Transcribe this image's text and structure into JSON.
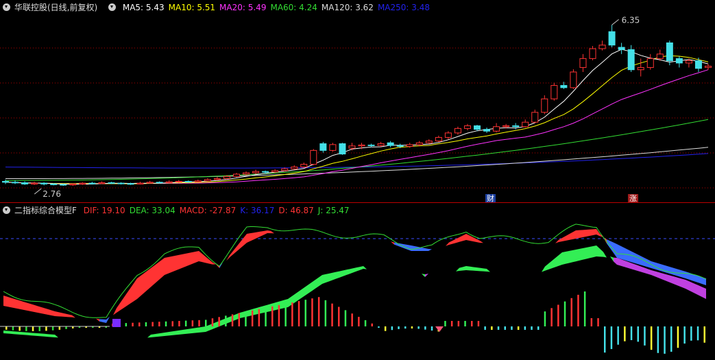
{
  "top": {
    "title": "华联控股(日线,前复权)",
    "legend": [
      {
        "label": "MA5: 5.43",
        "color": "#ffffff"
      },
      {
        "label": "MA10: 5.51",
        "color": "#ffff00"
      },
      {
        "label": "MA20: 5.49",
        "color": "#ff33ff"
      },
      {
        "label": "MA60: 4.24",
        "color": "#33dd33"
      },
      {
        "label": "MA120: 3.62",
        "color": "#dddddd"
      },
      {
        "label": "MA250: 3.48",
        "color": "#2222ee"
      }
    ],
    "high_label": "6.35",
    "low_label": "2.76",
    "tag_cai": "财",
    "tag_zhang": "涨"
  },
  "bottom": {
    "title": "二指标综合模型F",
    "legend": [
      {
        "label": "DIF: 19.10",
        "color": "#ff3333"
      },
      {
        "label": "DEA: 33.04",
        "color": "#33dd33"
      },
      {
        "label": "MACD: -27.87",
        "color": "#ff3333"
      },
      {
        "label": "K: 36.17",
        "color": "#2222ee"
      },
      {
        "label": "D: 46.87",
        "color": "#ff3333"
      },
      {
        "label": "J: 25.47",
        "color": "#33dd33"
      }
    ]
  },
  "colors": {
    "up": "#ff3333",
    "down": "#44e0e8",
    "ma5": "#ffffff",
    "ma10": "#ffff00",
    "ma20": "#ff33ff",
    "ma60": "#33dd33",
    "ma120": "#dddddd",
    "ma250": "#2222ee",
    "grid": "#b00000",
    "ribbon_red": "#ff3333",
    "ribbon_blue": "#3a6cff",
    "ribbon_purple": "#c040e0",
    "ribbon_green": "#33ee55"
  },
  "chart_data": [
    {
      "type": "candlestick",
      "title": "华联控股(日线,前复权)",
      "ylim": [
        2.5,
        6.6
      ],
      "candles": [
        [
          2.86,
          2.84,
          2.9,
          2.8
        ],
        [
          2.84,
          2.83,
          2.88,
          2.8
        ],
        [
          2.83,
          2.8,
          2.86,
          2.78
        ],
        [
          2.8,
          2.82,
          2.85,
          2.78
        ],
        [
          2.82,
          2.8,
          2.84,
          2.77
        ],
        [
          2.8,
          2.79,
          2.82,
          2.77
        ],
        [
          2.79,
          2.78,
          2.81,
          2.76
        ],
        [
          2.78,
          2.8,
          2.82,
          2.76
        ],
        [
          2.8,
          2.82,
          2.84,
          2.78
        ],
        [
          2.82,
          2.81,
          2.85,
          2.79
        ],
        [
          2.81,
          2.83,
          2.86,
          2.8
        ],
        [
          2.83,
          2.82,
          2.85,
          2.8
        ],
        [
          2.82,
          2.81,
          2.84,
          2.79
        ],
        [
          2.81,
          2.8,
          2.83,
          2.78
        ],
        [
          2.8,
          2.82,
          2.85,
          2.79
        ],
        [
          2.82,
          2.84,
          2.87,
          2.81
        ],
        [
          2.84,
          2.83,
          2.86,
          2.81
        ],
        [
          2.83,
          2.85,
          2.88,
          2.82
        ],
        [
          2.85,
          2.86,
          2.89,
          2.83
        ],
        [
          2.86,
          2.85,
          2.88,
          2.83
        ],
        [
          2.85,
          2.87,
          2.9,
          2.84
        ],
        [
          2.87,
          2.9,
          2.93,
          2.85
        ],
        [
          2.9,
          2.92,
          2.96,
          2.88
        ],
        [
          2.92,
          2.97,
          3.0,
          2.9
        ],
        [
          2.97,
          3.02,
          3.05,
          2.95
        ],
        [
          3.02,
          3.05,
          3.08,
          2.99
        ],
        [
          3.05,
          3.08,
          3.12,
          3.02
        ],
        [
          3.08,
          3.07,
          3.1,
          3.03
        ],
        [
          3.07,
          3.1,
          3.13,
          3.05
        ],
        [
          3.1,
          3.14,
          3.17,
          3.08
        ],
        [
          3.14,
          3.18,
          3.22,
          3.12
        ],
        [
          3.18,
          3.24,
          3.28,
          3.16
        ],
        [
          3.24,
          3.55,
          3.58,
          3.22
        ],
        [
          3.7,
          3.55,
          3.74,
          3.5
        ],
        [
          3.55,
          3.68,
          3.72,
          3.52
        ],
        [
          3.7,
          3.47,
          3.72,
          3.45
        ],
        [
          3.6,
          3.65,
          3.72,
          3.55
        ],
        [
          3.65,
          3.67,
          3.72,
          3.58
        ],
        [
          3.67,
          3.66,
          3.7,
          3.62
        ],
        [
          3.66,
          3.7,
          3.74,
          3.63
        ],
        [
          3.72,
          3.66,
          3.76,
          3.62
        ],
        [
          3.66,
          3.64,
          3.7,
          3.6
        ],
        [
          3.64,
          3.68,
          3.72,
          3.61
        ],
        [
          3.68,
          3.72,
          3.76,
          3.64
        ],
        [
          3.72,
          3.76,
          3.8,
          3.7
        ],
        [
          3.76,
          3.84,
          3.88,
          3.74
        ],
        [
          3.84,
          3.94,
          3.98,
          3.8
        ],
        [
          3.94,
          4.04,
          4.08,
          3.9
        ],
        [
          4.04,
          4.1,
          4.14,
          4.0
        ],
        [
          4.1,
          4.02,
          4.12,
          3.98
        ],
        [
          4.02,
          3.98,
          4.06,
          3.94
        ],
        [
          3.98,
          4.08,
          4.16,
          3.95
        ],
        [
          4.08,
          4.1,
          4.14,
          4.04
        ],
        [
          4.1,
          4.08,
          4.16,
          4.02
        ],
        [
          4.08,
          4.18,
          4.24,
          4.06
        ],
        [
          4.18,
          4.4,
          4.46,
          4.16
        ],
        [
          4.4,
          4.7,
          4.78,
          4.36
        ],
        [
          4.7,
          5.0,
          5.06,
          4.66
        ],
        [
          5.0,
          4.95,
          5.08,
          4.92
        ],
        [
          4.95,
          5.3,
          5.36,
          4.92
        ],
        [
          5.4,
          5.6,
          5.7,
          5.3
        ],
        [
          5.6,
          5.82,
          5.88,
          5.56
        ],
        [
          5.82,
          5.9,
          6.0,
          5.78
        ],
        [
          6.2,
          5.9,
          6.35,
          5.85
        ],
        [
          5.85,
          5.8,
          5.95,
          5.7
        ],
        [
          5.8,
          5.35,
          5.9,
          5.3
        ],
        [
          5.35,
          5.4,
          5.6,
          5.2
        ],
        [
          5.4,
          5.6,
          5.7,
          5.35
        ],
        [
          5.6,
          5.7,
          5.8,
          5.55
        ],
        [
          5.95,
          5.55,
          6.0,
          5.45
        ],
        [
          5.6,
          5.5,
          5.65,
          5.4
        ],
        [
          5.5,
          5.55,
          5.6,
          5.4
        ],
        [
          5.55,
          5.38,
          5.62,
          5.3
        ],
        [
          5.4,
          5.43,
          5.48,
          5.35
        ]
      ]
    },
    {
      "type": "indicator",
      "title": "二指标综合模型F",
      "series": [
        {
          "name": "DIF",
          "values": [
            19.1
          ]
        },
        {
          "name": "DEA",
          "values": [
            33.04
          ]
        },
        {
          "name": "MACD",
          "values": [
            -27.87
          ]
        },
        {
          "name": "K",
          "values": [
            36.17
          ]
        },
        {
          "name": "D",
          "values": [
            46.87
          ]
        },
        {
          "name": "J",
          "values": [
            25.47
          ]
        }
      ]
    }
  ]
}
